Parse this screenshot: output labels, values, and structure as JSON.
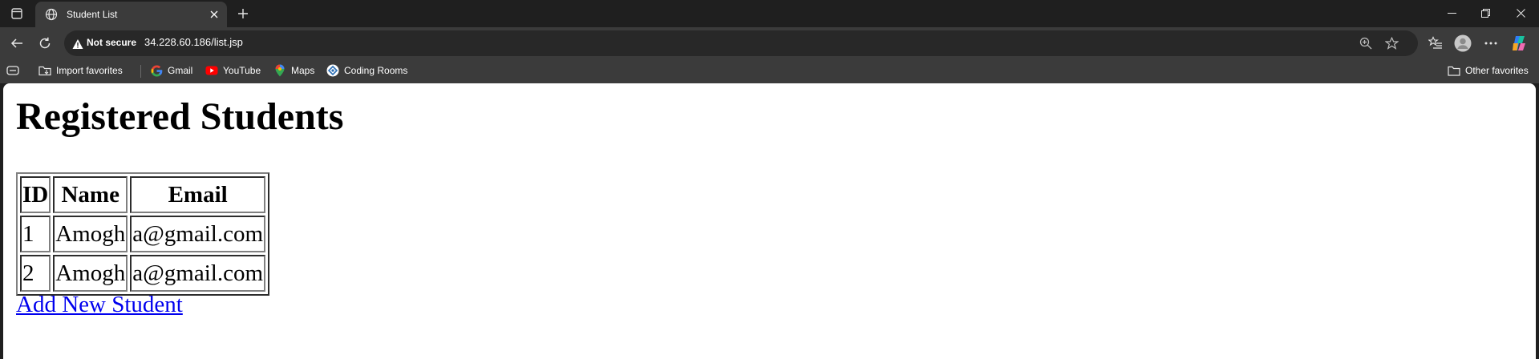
{
  "tab": {
    "title": "Student List"
  },
  "address_bar": {
    "security_label": "Not secure",
    "url": "34.228.60.186/list.jsp"
  },
  "bookmarks": {
    "items": [
      {
        "label": "Import favorites",
        "icon": "import-icon"
      },
      {
        "label": "Gmail",
        "icon": "google-icon"
      },
      {
        "label": "YouTube",
        "icon": "youtube-icon"
      },
      {
        "label": "Maps",
        "icon": "maps-icon"
      },
      {
        "label": "Coding Rooms",
        "icon": "coding-rooms-icon"
      }
    ],
    "other_favorites": "Other favorites"
  },
  "page": {
    "heading": "Registered Students",
    "table": {
      "headers": [
        "ID",
        "Name",
        "Email"
      ],
      "rows": [
        [
          "1",
          "Amogh",
          "a@gmail.com"
        ],
        [
          "2",
          "Amogh",
          "a@gmail.com"
        ]
      ]
    },
    "link": "Add New Student"
  },
  "colors": {
    "browser_frame": "#1f1f1f",
    "toolbar": "#3b3b3b",
    "omnibox": "#282828",
    "page_background": "#ffffff",
    "link": "#0000ee"
  }
}
